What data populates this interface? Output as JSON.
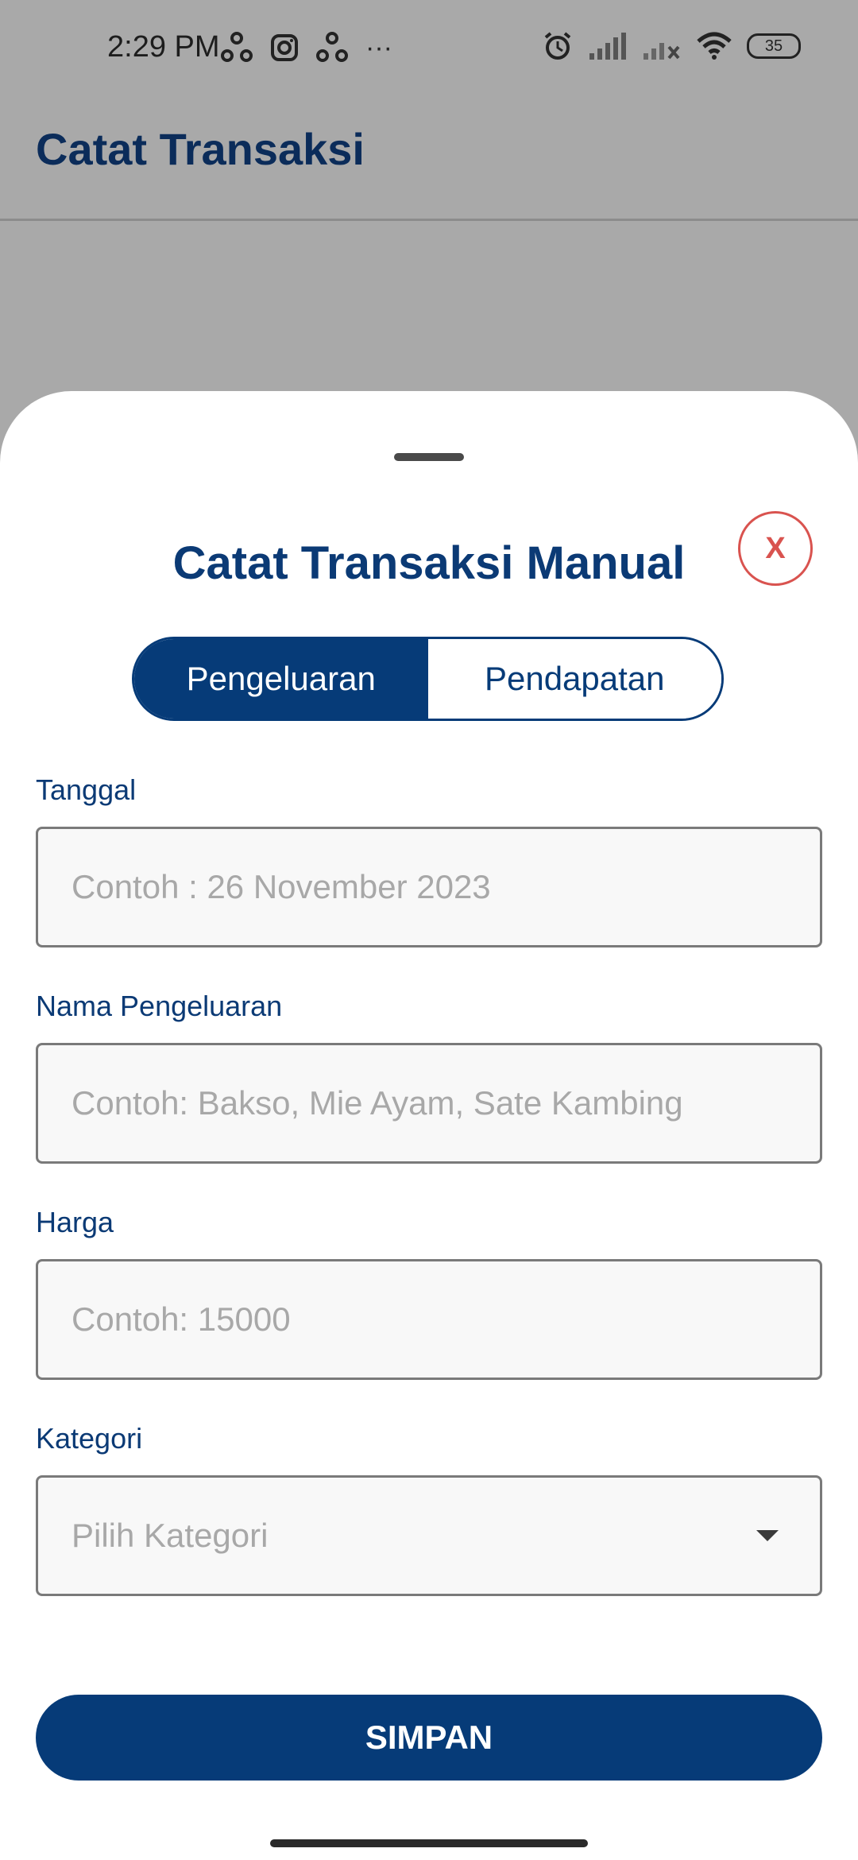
{
  "status_bar": {
    "time": "2:29 PM",
    "more": "···",
    "battery": "35"
  },
  "app_bar": {
    "title": "Catat Transaksi"
  },
  "sheet": {
    "title": "Catat Transaksi Manual",
    "close_label": "X",
    "tabs": [
      {
        "label": "Pengeluaran",
        "active": true
      },
      {
        "label": "Pendapatan",
        "active": false
      }
    ],
    "fields": {
      "date": {
        "label": "Tanggal",
        "placeholder": "Contoh : 26 November 2023",
        "value": ""
      },
      "name": {
        "label": "Nama Pengeluaran",
        "placeholder": "Contoh: Bakso, Mie Ayam, Sate Kambing",
        "value": ""
      },
      "price": {
        "label": "Harga",
        "placeholder": "Contoh: 15000",
        "value": ""
      },
      "category": {
        "label": "Kategori",
        "placeholder": "Pilih Kategori"
      }
    },
    "save_label": "SIMPAN"
  },
  "colors": {
    "primary": "#063b78",
    "close": "#d9534f",
    "overlay": "#a9a9a9"
  }
}
